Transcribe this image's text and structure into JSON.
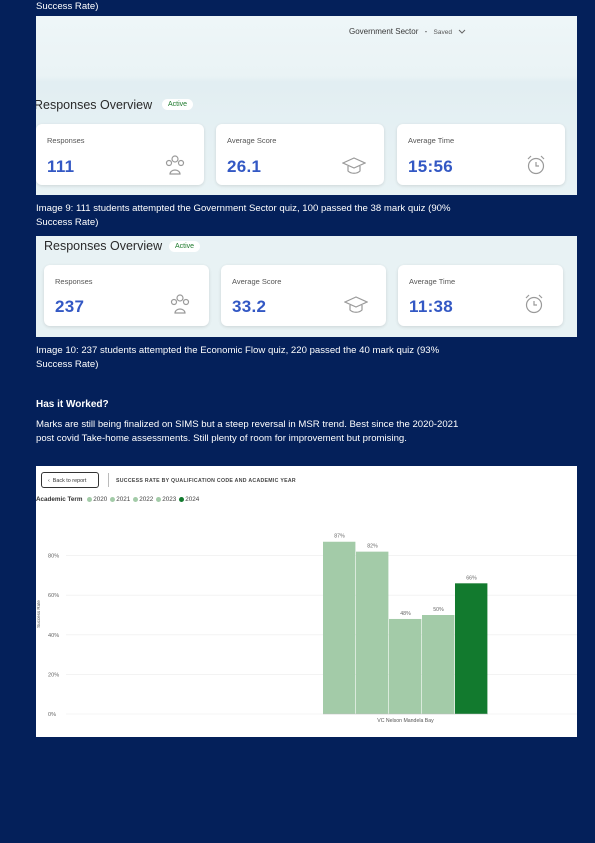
{
  "page": {
    "caption_prev_end": "Success Rate)",
    "caption_9_line1": "Image 9: 111 students attempted the Government Sector quiz, 100 passed the 38 mark quiz (90%",
    "caption_9_line2": "Success Rate)",
    "caption_10_line1": "Image 10: 237 students attempted the Economic Flow quiz, 220 passed the 40 mark quiz (93%",
    "caption_10_line2": "Success Rate)",
    "section_heading": "Has it Worked?",
    "body_line1": "Marks are still being finalized on SIMS but a steep reversal in MSR trend. Best since the 2020-2021",
    "body_line2": "post covid Take-home assessments. Still plenty of room for improvement but promising."
  },
  "screenshot1": {
    "topbar": "Government Sector",
    "sep": "-",
    "saved": "Saved",
    "title": "Responses Overview",
    "badge": "Active",
    "cards": [
      {
        "label": "Responses",
        "value": "111",
        "icon": "people-icon"
      },
      {
        "label": "Average Score",
        "value": "26.1",
        "icon": "graduation-cap-icon"
      },
      {
        "label": "Average Time",
        "value": "15:56",
        "icon": "alarm-clock-icon"
      }
    ]
  },
  "screenshot2": {
    "title": "Responses Overview",
    "badge": "Active",
    "cards": [
      {
        "label": "Responses",
        "value": "237",
        "icon": "people-icon"
      },
      {
        "label": "Average Score",
        "value": "33.2",
        "icon": "graduation-cap-icon"
      },
      {
        "label": "Average Time",
        "value": "11:38",
        "icon": "alarm-clock-icon"
      }
    ]
  },
  "chart_header": {
    "back": "Back to report",
    "title": "SUCCESS RATE BY QUALIFICATION CODE AND ACADEMIC YEAR",
    "legend_title": "Academic Term"
  },
  "colors": {
    "page_bg": "#04205a",
    "accent_value": "#3358c4",
    "bar_light": "#a3cba8",
    "bar_dark": "#127a2e",
    "active_badge": "#1d7a2c"
  },
  "chart_data": {
    "type": "bar",
    "title": "SUCCESS RATE BY QUALIFICATION CODE AND ACADEMIC YEAR",
    "xlabel": "",
    "ylabel": "Success Rate",
    "categories": [
      "VC Nelson Mandela Bay"
    ],
    "series": [
      {
        "name": "2020",
        "values": [
          87
        ],
        "label": "87%",
        "color": "#a3cba8"
      },
      {
        "name": "2021",
        "values": [
          82
        ],
        "label": "82%",
        "color": "#a3cba8"
      },
      {
        "name": "2022",
        "values": [
          48
        ],
        "label": "48%",
        "color": "#a3cba8"
      },
      {
        "name": "2023",
        "values": [
          50
        ],
        "label": "50%",
        "color": "#a3cba8"
      },
      {
        "name": "2024",
        "values": [
          66
        ],
        "label": "66%",
        "color": "#127a2e"
      }
    ],
    "yticks": [
      "0%",
      "20%",
      "40%",
      "60%",
      "80%"
    ],
    "ylim": [
      0,
      100
    ],
    "grid": true,
    "legend_position": "top-left"
  }
}
